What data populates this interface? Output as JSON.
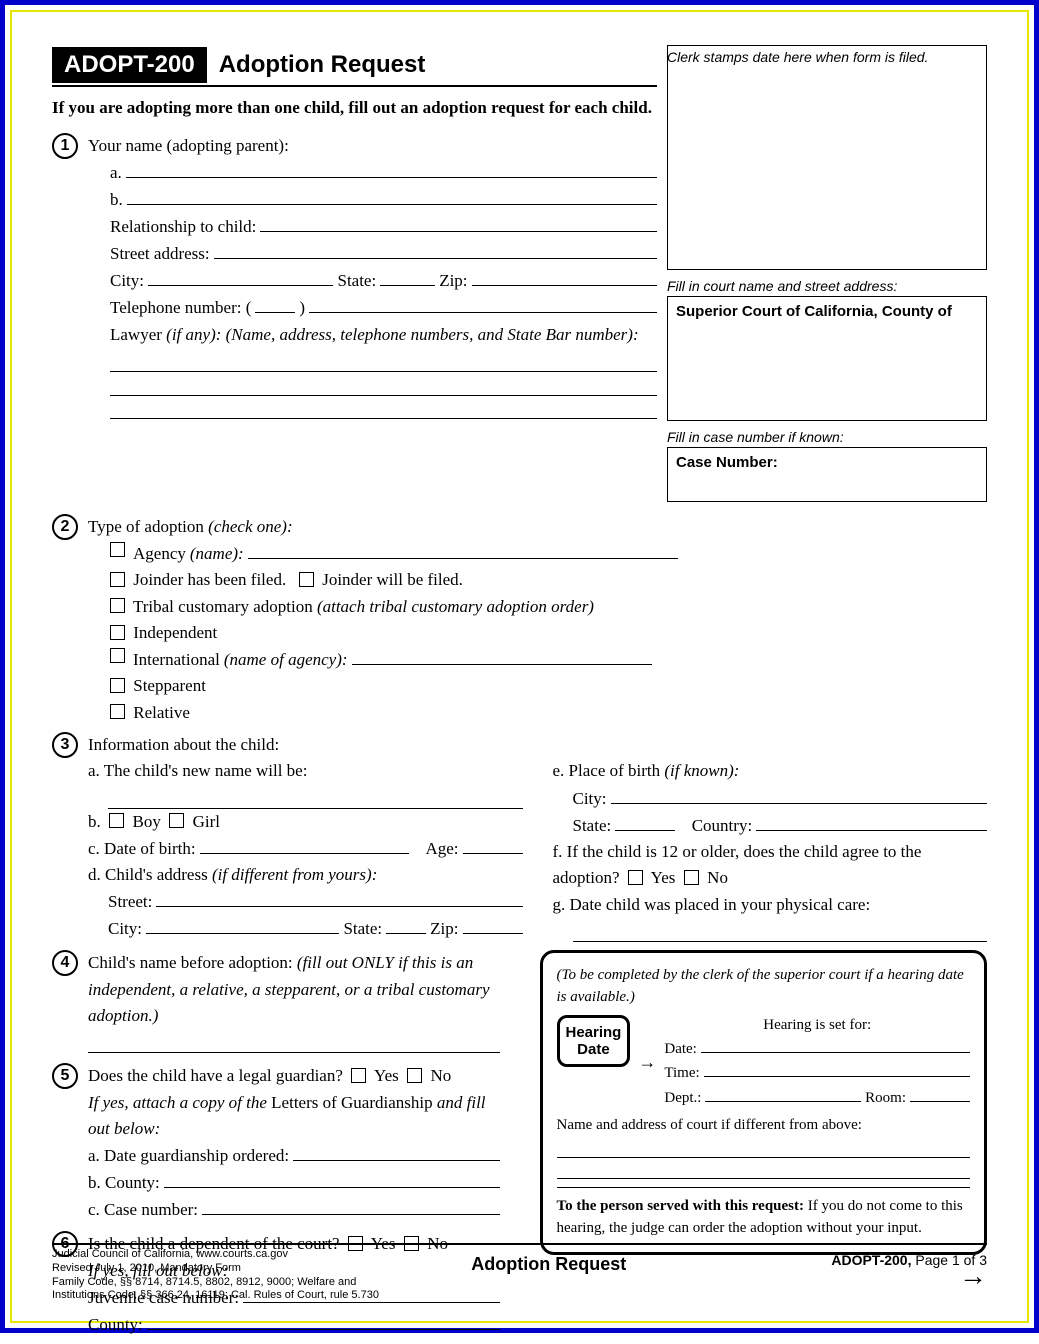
{
  "header": {
    "form_code": "ADOPT-200",
    "title": "Adoption Request",
    "instruction": "If you are adopting more than one child, fill out an adoption request for each child."
  },
  "right": {
    "clerk_label": "Clerk stamps date here when form is filed.",
    "court_label": "Fill in court name and street address:",
    "court_title": "Superior Court of California, County of",
    "case_label": "Fill in case number if known:",
    "case_title": "Case Number:"
  },
  "s1": {
    "num": "1",
    "title": "Your name (adopting parent):",
    "a": "a.",
    "b": "b.",
    "rel": "Relationship to child:",
    "street": "Street address:",
    "city": "City:",
    "state": "State:",
    "zip": "Zip:",
    "tel": "Telephone number: (",
    "tel2": ")",
    "lawyer": "Lawyer",
    "lawyer_hint": "(if any): (Name, address, telephone numbers, and State Bar number):"
  },
  "s2": {
    "num": "2",
    "title": "Type of adoption",
    "hint": "(check one):",
    "agency": "Agency",
    "agency_hint": "(name):",
    "joinder1": "Joinder has been filed.",
    "joinder2": "Joinder will be filed.",
    "tribal": "Tribal customary adoption",
    "tribal_hint": "(attach tribal customary adoption order)",
    "independent": "Independent",
    "international": "International",
    "international_hint": "(name of agency):",
    "stepparent": "Stepparent",
    "relative": "Relative"
  },
  "s3": {
    "num": "3",
    "title": "Information about the child:",
    "a": "a.  The child's new name will be:",
    "b": "b.",
    "boy": "Boy",
    "girl": "Girl",
    "c": "c.  Date of birth:",
    "age": "Age:",
    "d": "d.  Child's address",
    "d_hint": "(if different from yours):",
    "street": "Street:",
    "city": "City:",
    "state": "State:",
    "zip": "Zip:",
    "e": "e.  Place of birth",
    "e_hint": "(if known):",
    "e_city": "City:",
    "e_state": "State:",
    "e_country": "Country:",
    "f": "f.  If the child is 12 or older, does the child agree to the adoption?",
    "yes": "Yes",
    "no": "No",
    "g": "g.  Date child was placed in your physical care:"
  },
  "s4": {
    "num": "4",
    "title": "Child's name before adoption:",
    "hint": "(fill out ONLY if this is an independent, a relative, a stepparent, or a tribal customary adoption.)"
  },
  "s5": {
    "num": "5",
    "title": "Does the child have a legal guardian?",
    "yes": "Yes",
    "no": "No",
    "hint1": "If yes, attach a copy of the",
    "letters": "Letters of Guardianship",
    "hint2": "and fill out below:",
    "a": "a.  Date guardianship ordered:",
    "b": "b.  County:",
    "c": "c.  Case number:"
  },
  "s6": {
    "num": "6",
    "title": "Is the child a dependent of the court?",
    "yes": "Yes",
    "no": "No",
    "hint": "If yes, fill out below:",
    "juv": "Juvenile case number:",
    "county": "County:"
  },
  "hearing": {
    "intro": "(To be completed by the clerk of the superior court if a hearing date is available.)",
    "set": "Hearing is set for:",
    "badge1": "Hearing",
    "badge2": "Date",
    "date": "Date:",
    "time": "Time:",
    "dept": "Dept.:",
    "room": "Room:",
    "addr": "Name and address of court if different from above:",
    "served_bold": "To the person served with this request:",
    "served_rest": "If you do not come to this hearing, the judge can order the adoption without your input."
  },
  "footer": {
    "l1": "Judicial Council of California, www.courts.ca.gov",
    "l2": "Revised July 1, 2010, Mandatory Form",
    "l3": "Family Code, §§ 8714, 8714.5, 8802, 8912, 9000; Welfare and",
    "l4": "Institutions Code, §§ 366.24, 16119; Cal. Rules of Court, rule 5.730",
    "center": "Adoption Request",
    "right_code": "ADOPT-200,",
    "right_page": "Page 1 of 3"
  }
}
